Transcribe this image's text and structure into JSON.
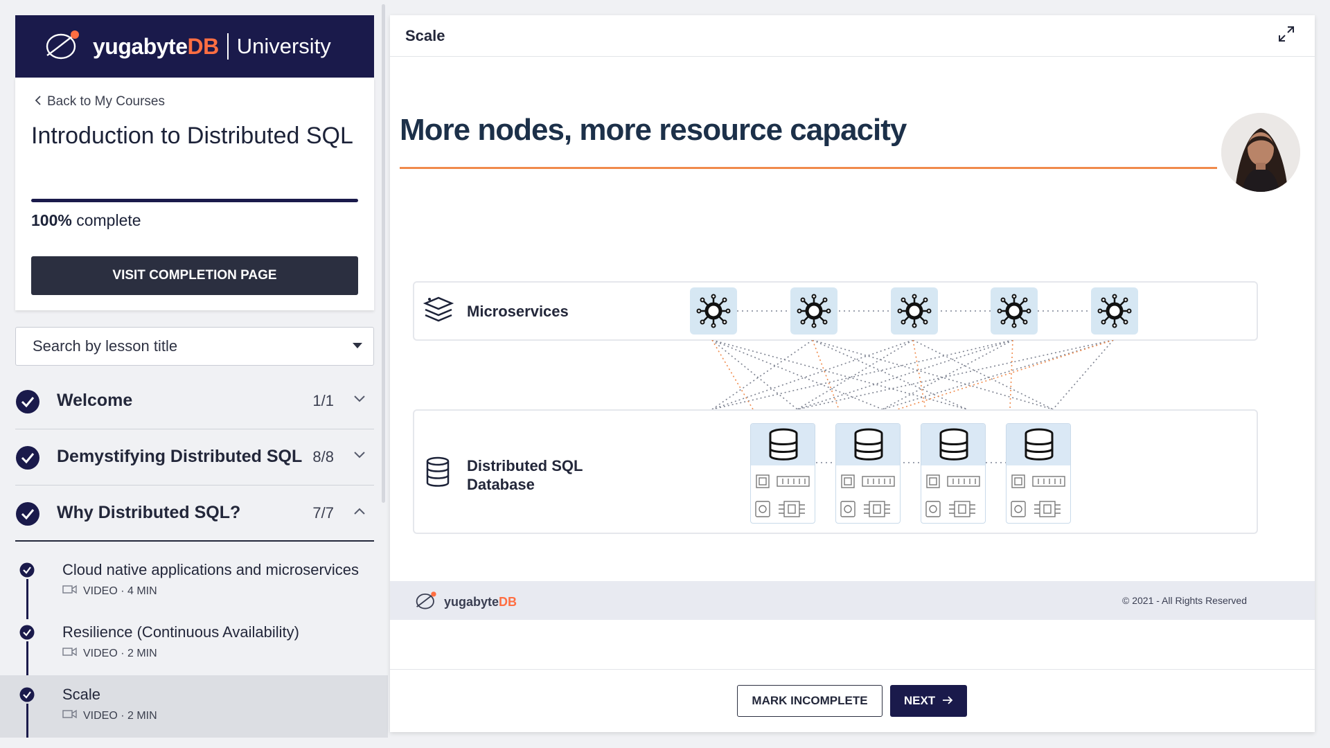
{
  "sidebar": {
    "brand": {
      "wordmark_main": "yugabyte",
      "wordmark_accent": "DB",
      "suffix": "University"
    },
    "back_link": "Back to My Courses",
    "course_title": "Introduction to Distributed SQL",
    "progress": {
      "percent": "100%",
      "label": "complete",
      "fraction": 1.0
    },
    "completion_button": "VISIT COMPLETION PAGE",
    "search_placeholder": "Search by lesson title",
    "sections": [
      {
        "title": "Welcome",
        "count": "1/1",
        "expanded": false
      },
      {
        "title": "Demystifying Distributed SQL",
        "count": "8/8",
        "expanded": false
      },
      {
        "title": "Why Distributed SQL?",
        "count": "7/7",
        "expanded": true
      }
    ],
    "lessons": [
      {
        "title": "Cloud native applications and microservices",
        "meta": "VIDEO · 4 MIN",
        "completed": true,
        "active": false
      },
      {
        "title": "Resilience (Continuous Availability)",
        "meta": "VIDEO · 2 MIN",
        "completed": true,
        "active": false
      },
      {
        "title": "Scale",
        "meta": "VIDEO · 2 MIN",
        "completed": true,
        "active": true
      }
    ]
  },
  "main": {
    "lesson_label": "Scale",
    "slide": {
      "heading": "More nodes, more resource capacity",
      "tier_top_label": "Microservices",
      "tier_bottom_label": "Distributed SQL Database",
      "footer_brand_main": "yugabyte",
      "footer_brand_accent": "DB",
      "copyright": "© 2021 - All Rights Reserved",
      "accent_color": "#f08a4b"
    },
    "buttons": {
      "mark_incomplete": "MARK INCOMPLETE",
      "next": "NEXT"
    }
  }
}
